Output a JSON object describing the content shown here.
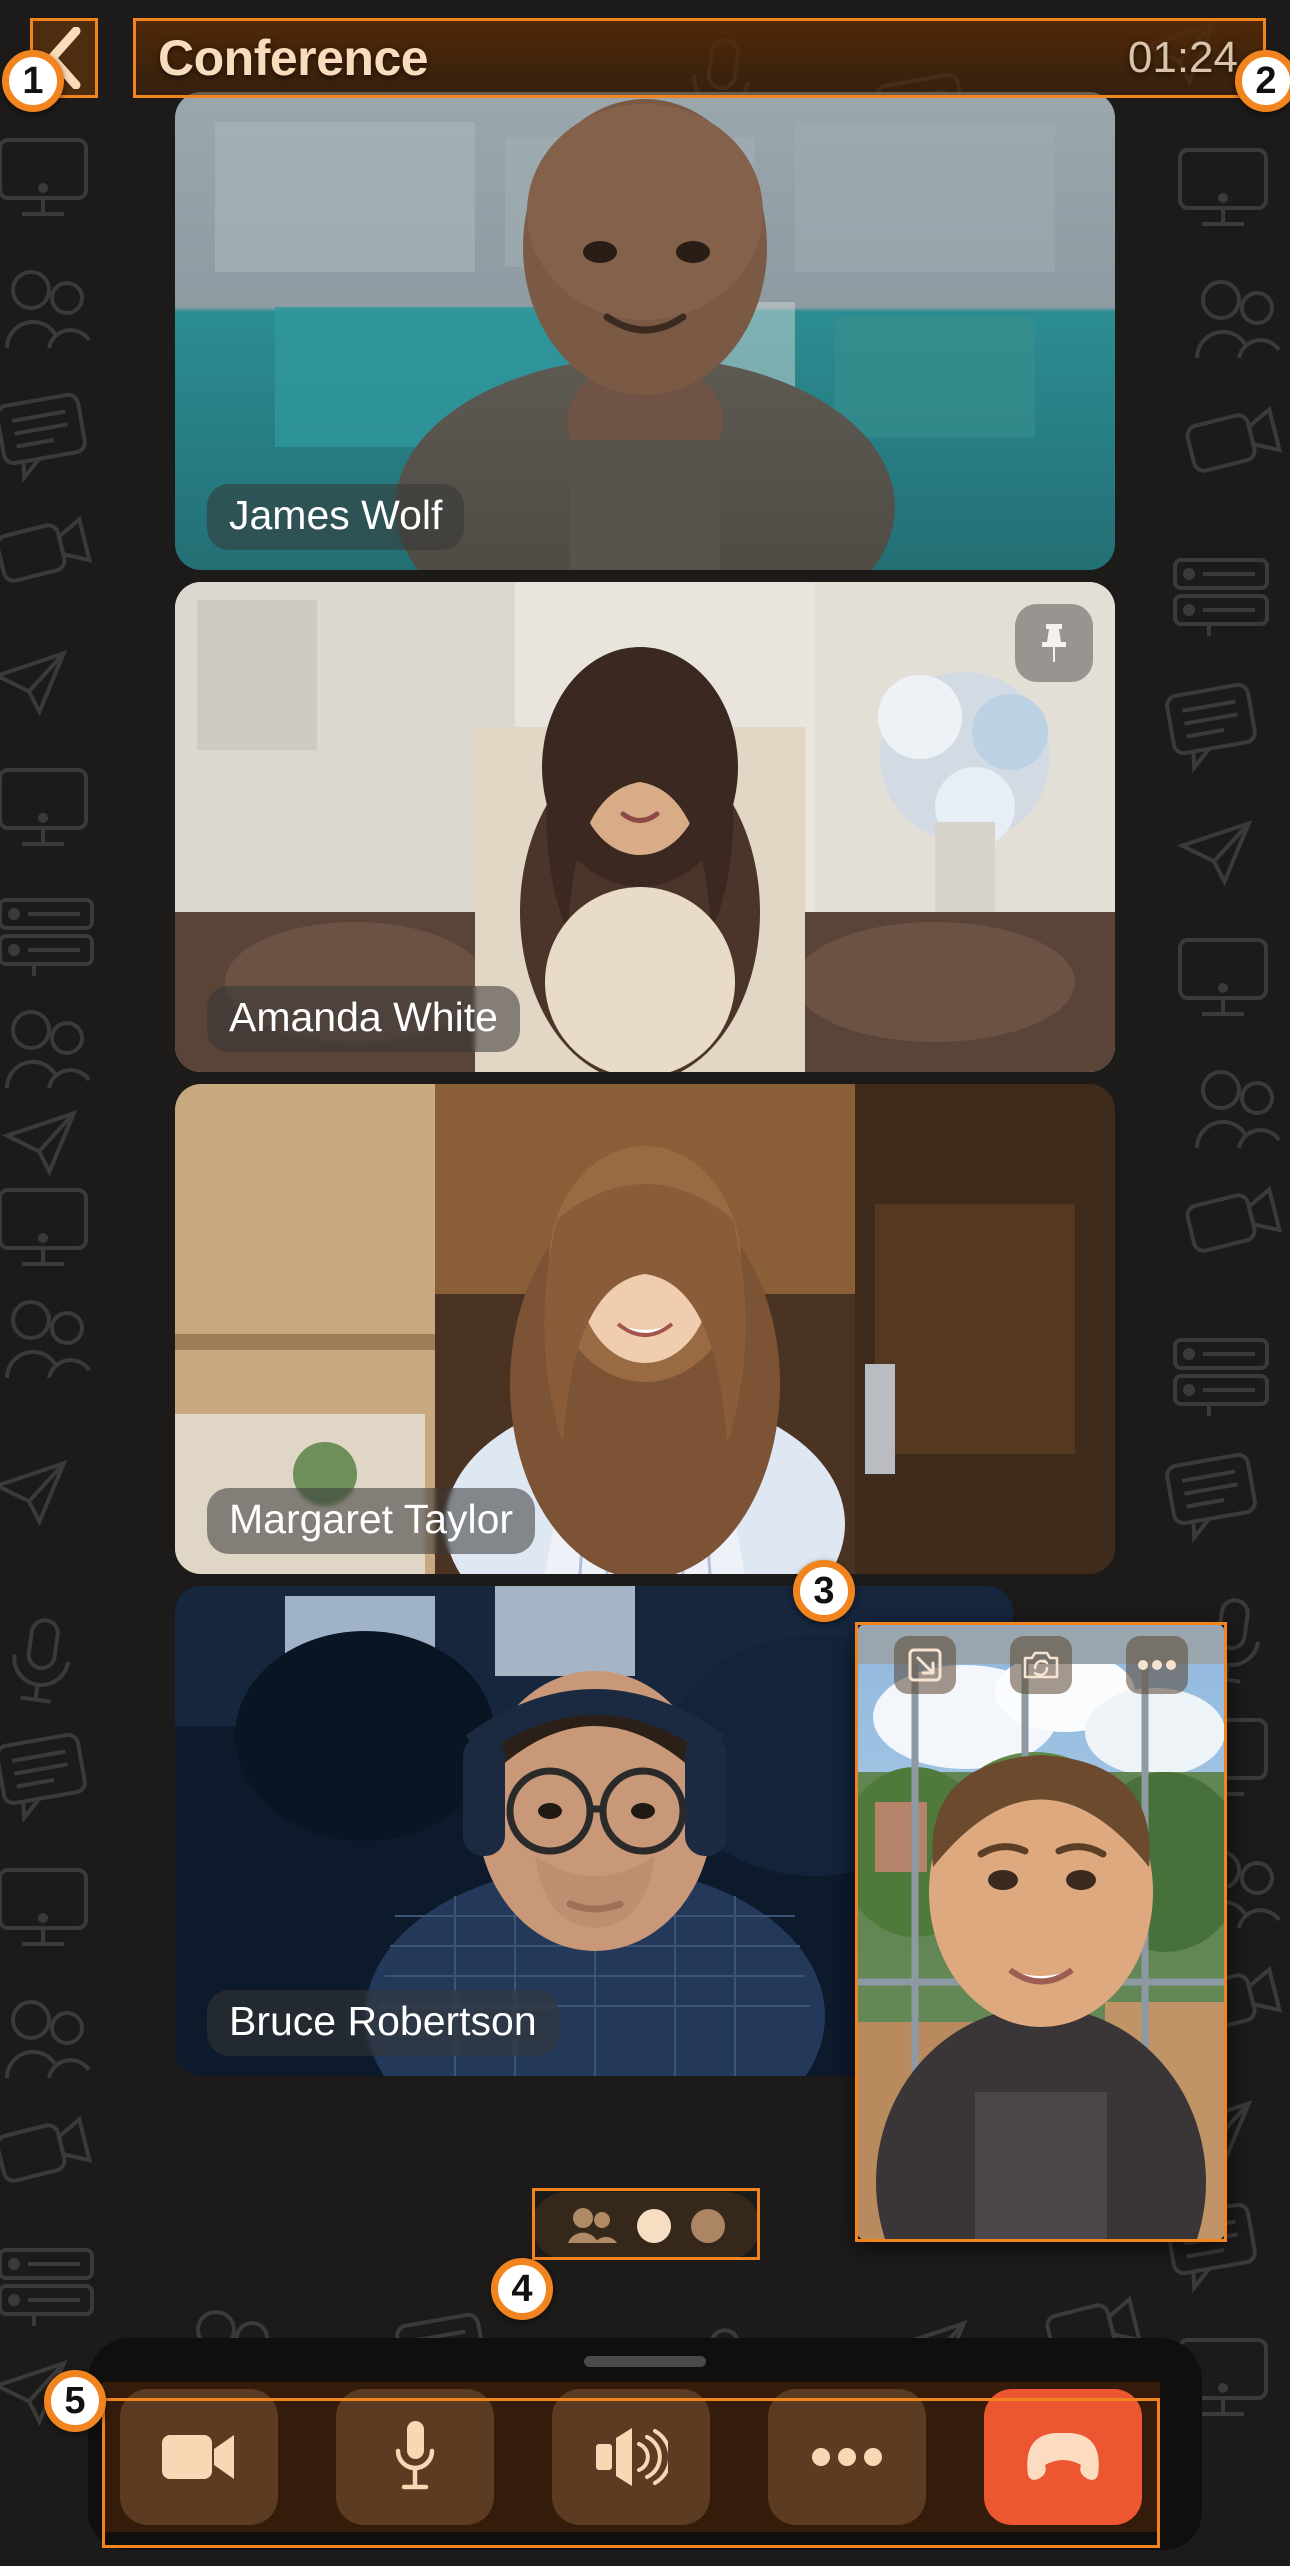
{
  "header": {
    "back_icon": "chevron-left-icon",
    "title": "Conference",
    "timer": "01:24"
  },
  "participants": [
    {
      "name": "James Wolf",
      "pinned": false
    },
    {
      "name": "Amanda White",
      "pinned": true,
      "pin_icon": "pin-icon"
    },
    {
      "name": "Margaret Taylor",
      "pinned": false
    },
    {
      "name": "Bruce Robertson",
      "pinned": false
    }
  ],
  "self_view": {
    "controls": [
      {
        "icon": "resize-collapse-icon",
        "label": "Resize"
      },
      {
        "icon": "camera-flip-icon",
        "label": "Flip camera"
      },
      {
        "icon": "more-horizontal-icon",
        "label": "More"
      }
    ]
  },
  "page_indicator": {
    "people_icon": "people-icon",
    "pages": 2,
    "active_page": 1
  },
  "toolbar": {
    "buttons": [
      {
        "icon": "video-camera-icon",
        "label": "Camera",
        "style": "normal"
      },
      {
        "icon": "microphone-icon",
        "label": "Microphone",
        "style": "normal"
      },
      {
        "icon": "speaker-icon",
        "label": "Speaker",
        "style": "normal"
      },
      {
        "icon": "more-icon",
        "label": "More",
        "style": "normal"
      },
      {
        "icon": "hang-up-icon",
        "label": "End call",
        "style": "danger"
      }
    ]
  },
  "annotations": [
    {
      "id": "1",
      "target": "back-button"
    },
    {
      "id": "2",
      "target": "call-timer"
    },
    {
      "id": "3",
      "target": "self-view-pip"
    },
    {
      "id": "4",
      "target": "page-indicator"
    },
    {
      "id": "5",
      "target": "bottom-toolbar"
    }
  ],
  "colors": {
    "accent": "#f2841f",
    "danger": "#ec5630",
    "title_text": "#f9dcbe",
    "timer_text": "#d9c3ab",
    "toolbar_btn": "#5b3b22",
    "background": "#1c1b19"
  }
}
